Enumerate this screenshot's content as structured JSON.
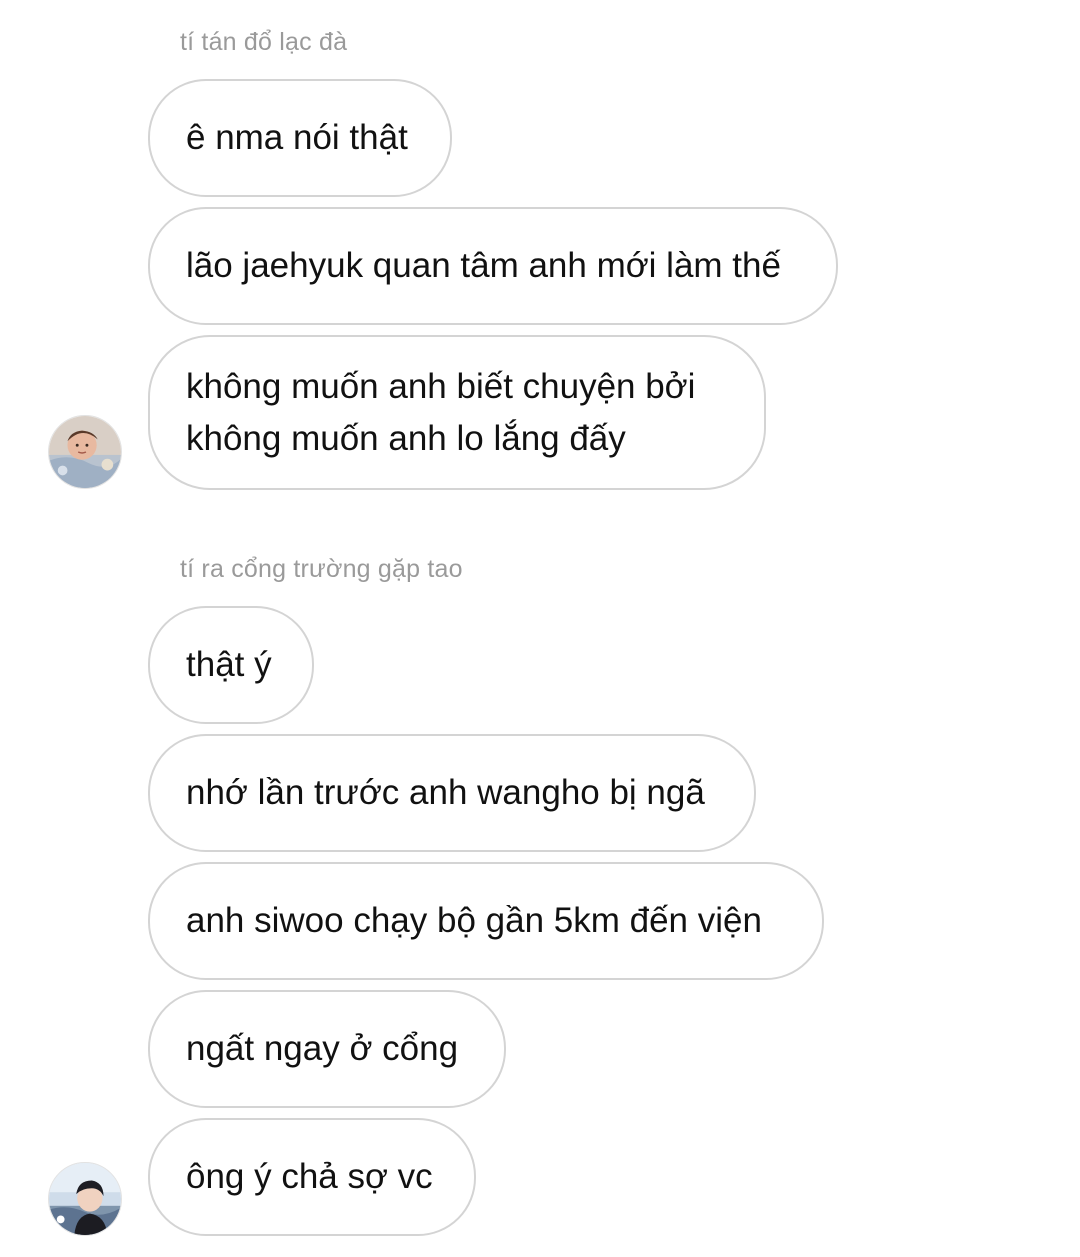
{
  "thread": {
    "groups": [
      {
        "sender": "tí tán đổ lạc đà",
        "avatar_icon": "user-avatar-photo-1",
        "messages": [
          "ê nma nói thật",
          "lão jaehyuk quan tâm anh mới làm thế",
          "không muốn anh biết chuyện bởi\nkhông muốn anh lo lắng đấy"
        ]
      },
      {
        "sender": "tí ra cổng trường gặp tao",
        "avatar_icon": "user-avatar-photo-2",
        "messages": [
          "thật ý",
          "nhớ lần trước anh wangho bị ngã",
          "anh siwoo chạy bộ gần 5km đến viện",
          "ngất ngay ở cổng",
          "ông ý chả sợ vc"
        ]
      }
    ]
  },
  "colors": {
    "bubble_border": "#d4d4d4",
    "sender_name": "#9a9a9a",
    "text": "#111111",
    "background": "#ffffff"
  }
}
